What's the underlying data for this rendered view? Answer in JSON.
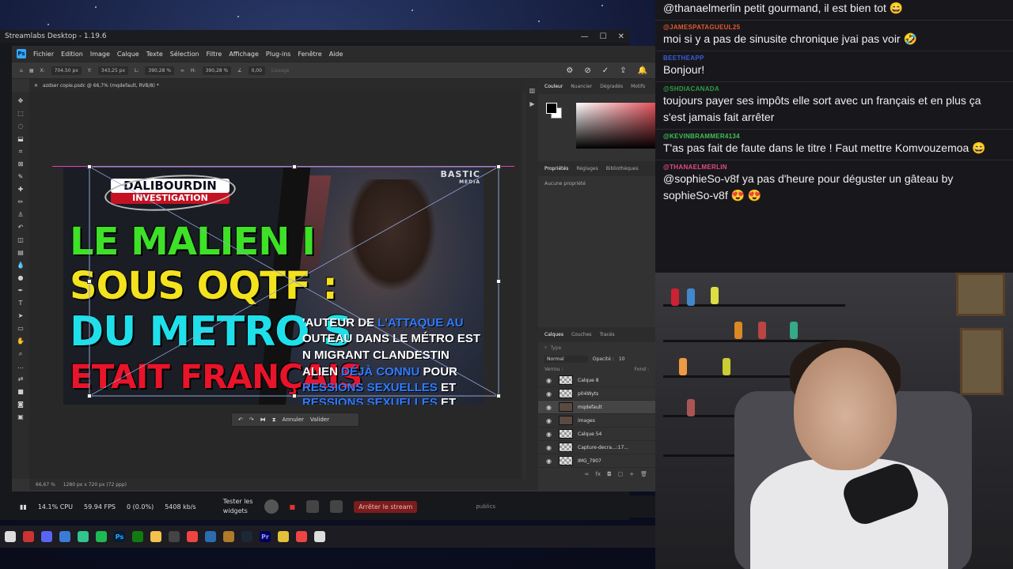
{
  "streamlabs": {
    "title": "Streamlabs Desktop - 1.19.6",
    "controls": [
      "—",
      "☐",
      "✕"
    ],
    "stats": {
      "cpu": "14.1% CPU",
      "fps": "59.94 FPS",
      "dropped": "0 (0.0%)",
      "bitrate": "5408 kb/s"
    },
    "widgets_label_1": "Tester les",
    "widgets_label_2": "widgets",
    "stop_stream": "Arrêter le stream",
    "publics": "publics"
  },
  "photoshop": {
    "menu": [
      "Fichier",
      "Edition",
      "Image",
      "Calque",
      "Texte",
      "Sélection",
      "Filtre",
      "Affichage",
      "Plug-ins",
      "Fenêtre",
      "Aide"
    ],
    "options": {
      "x": "704,50 px",
      "y": "343,25 px",
      "w": "390,28 %",
      "h": "390,28 %",
      "angle": "0,00",
      "interp": "Lissage"
    },
    "doc_tab": "azdser copie.psdc @ 66,7% (mqdefault, RVB/8) *",
    "status_zoom": "66,67 %",
    "status_info": "1280 px x 720 px (72 ppp)",
    "transform_bar": {
      "cancel": "Annuler",
      "commit": "Valider"
    },
    "panels": {
      "color_tabs": [
        "Couleur",
        "Nuancier",
        "Dégradés",
        "Motifs"
      ],
      "props_tabs": [
        "Propriétés",
        "Réglages",
        "Bibliothèques"
      ],
      "props_empty": "Aucune propriété",
      "layers_tabs": [
        "Calques",
        "Couches",
        "Tracés"
      ],
      "search_placeholder": "Type",
      "blend_mode": "Normal",
      "opacity_label": "Opacité :",
      "opacity_value": "10",
      "lock_label": "Verrou :",
      "fill_label": "Fond :",
      "layers": [
        {
          "name": "Calque 8",
          "selected": false
        },
        {
          "name": "p04Wyts",
          "selected": false
        },
        {
          "name": "mqdefault",
          "selected": true
        },
        {
          "name": "images",
          "selected": false
        },
        {
          "name": "Calque 54",
          "selected": false
        },
        {
          "name": "Capture-decra...:17...",
          "selected": false
        },
        {
          "name": "IMG_7907",
          "selected": false
        }
      ]
    }
  },
  "thumbnail": {
    "brand_line1": "DALIBOURDIN",
    "brand_line2": "INVESTIGATION",
    "watermark": "BASTIC",
    "watermark_sub": "MEDIA",
    "headline": [
      "LE MALIEN I",
      "SOUS OQTF :",
      "DU METRO S",
      "ETAIT FRANÇAIS"
    ],
    "caption_lines": [
      {
        "pre": "'AUTEUR DE ",
        "blue": "L'ATTAQUE AU",
        "post": ""
      },
      {
        "pre": "OUTEAU ",
        "blue": "",
        "post": "DANS LE MÉTRO EST"
      },
      {
        "pre": "N MIGRANT CLANDESTIN",
        "blue": "",
        "post": ""
      },
      {
        "pre": "ALIEN ",
        "blue": "DÉJÀ CONNU",
        "post": " POUR"
      },
      {
        "pre": "",
        "blue": "RESSIONS SEXUELLES",
        "post": " ET"
      },
      {
        "pre": "",
        "blue": "RESSIONS SEXUELLES",
        "post": " ET"
      }
    ]
  },
  "chat": {
    "messages": [
      {
        "user": "",
        "text": "@thanaelmerlin petit gourmand, il est bien tot 😄",
        "color": "#9c6bd6"
      },
      {
        "user": "@JAMESPATAGUEUL25",
        "text": "moi si y a pas de sinusite chronique jvai pas voir 🤣",
        "color": "#e4572e"
      },
      {
        "user": "BEETHEAPP",
        "text": "Bonjour!",
        "color": "#3b5bdb"
      },
      {
        "user": "@SHDIACANADA",
        "text": "toujours payer ses impôts elle sort avec un français et en plus ça s'est jamais fait arrêter",
        "color": "#2f9e44"
      },
      {
        "user": "@KEVINBRAMMER4134",
        "text": "T'as pas fait de faute dans le titre ! Faut mettre Komvouzemoa 😄",
        "color": "#40c057"
      },
      {
        "user": "@THANAELMERLIN",
        "text": "@sophieSo-v8f ya pas d'heure pour déguster un gâteau by sophieSo-v8f 😍 😍",
        "color": "#e64980"
      }
    ]
  }
}
